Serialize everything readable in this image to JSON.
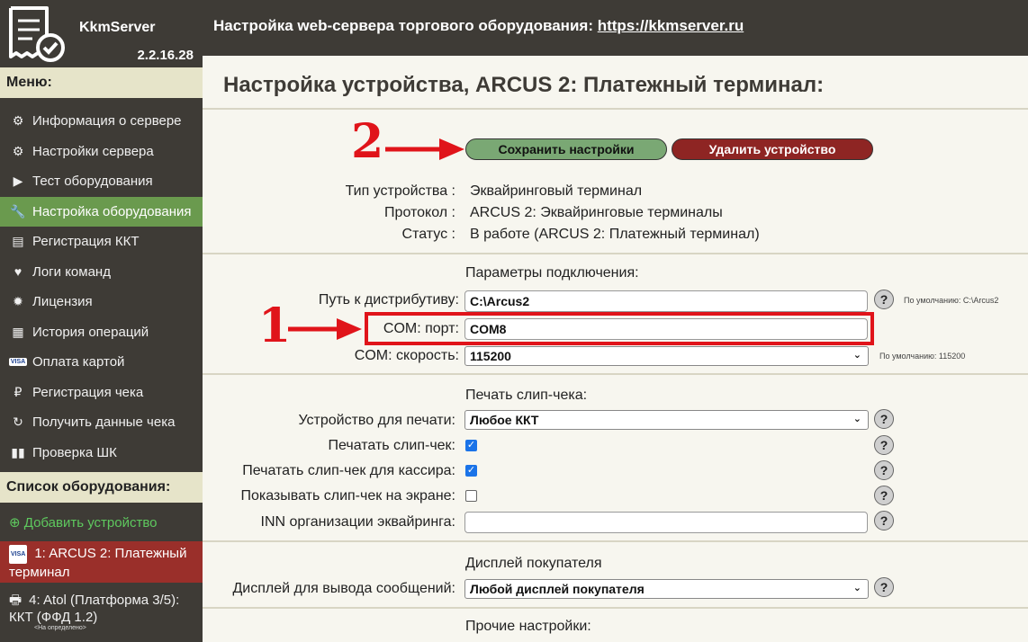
{
  "app": {
    "name": "KkmServer",
    "version": "2.2.16.28"
  },
  "header": {
    "text": "Настройка web-сервера торгового оборудования:",
    "link": "https://kkmserver.ru"
  },
  "sidebar": {
    "menu_title": "Меню:",
    "items": [
      {
        "label": "Информация о сервере",
        "icon": "gear-icon"
      },
      {
        "label": "Настройки сервера",
        "icon": "gears-icon"
      },
      {
        "label": "Тест оборудования",
        "icon": "play-icon"
      },
      {
        "label": "Настройка оборудования",
        "icon": "wrench-icon",
        "active": true
      },
      {
        "label": "Регистрация ККТ",
        "icon": "list-icon"
      },
      {
        "label": "Логи команд",
        "icon": "heartbeat-icon"
      },
      {
        "label": "Лицензия",
        "icon": "certificate-icon"
      },
      {
        "label": "История операций",
        "icon": "calendar-icon"
      },
      {
        "label": "Оплата картой",
        "icon": "visa-icon"
      },
      {
        "label": "Регистрация чека",
        "icon": "ruble-icon"
      },
      {
        "label": "Получить данные чека",
        "icon": "refresh-icon"
      },
      {
        "label": "Проверка ШК",
        "icon": "barcode-icon"
      }
    ],
    "equipment_title": "Список оборудования:",
    "add_device": "Добавить устройство",
    "devices": [
      {
        "label": "1: ARCUS 2: Платежный терминал",
        "active": true
      },
      {
        "label": "4: Atol (Платформа 3/5): ККТ (ФФД 1.2)",
        "note": "<На определено>"
      }
    ]
  },
  "main": {
    "title": "Настройка устройства, ARCUS 2: Платежный терминал:",
    "save_label": "Сохранить настройки",
    "delete_label": "Удалить устройство",
    "info": [
      {
        "label": "Тип устройства :",
        "value": "Эквайринговый терминал"
      },
      {
        "label": "Протокол :",
        "value": "ARCUS 2: Эквайринговые терминалы"
      },
      {
        "label": "Статус :",
        "value": "В работе (ARCUS 2: Платежный терминал)"
      }
    ],
    "connection": {
      "title": "Параметры подключения:",
      "path_label": "Путь к дистрибутиву:",
      "path_value": "C:\\Arcus2",
      "path_default": "По умолчанию: C:\\Arcus2",
      "port_label": "COM: порт:",
      "port_value": "COM8",
      "speed_label": "COM: скорость:",
      "speed_value": "115200",
      "speed_default": "По умолчанию: 115200"
    },
    "slip": {
      "title": "Печать слип-чека:",
      "device_label": "Устройство для печати:",
      "device_value": "Любое ККТ",
      "print_label": "Печатать слип-чек:",
      "print_checked": true,
      "cashier_label": "Печатать слип-чек для кассира:",
      "cashier_checked": true,
      "screen_label": "Показывать слип-чек на экране:",
      "screen_checked": false,
      "inn_label": "INN организации эквайринга:",
      "inn_value": ""
    },
    "display": {
      "title": "Дисплей покупателя",
      "label": "Дисплей для вывода сообщений:",
      "value": "Любой дисплей покупателя"
    },
    "other": {
      "title": "Прочие настройки:"
    }
  },
  "annotations": {
    "step1": "1",
    "step2": "2"
  },
  "colors": {
    "sidebar": "#3e3b36",
    "active": "#6a9a4e",
    "device_active": "#9a2f2a",
    "save": "#7aa874",
    "delete": "#8e2523",
    "annotation": "#e0141a"
  }
}
